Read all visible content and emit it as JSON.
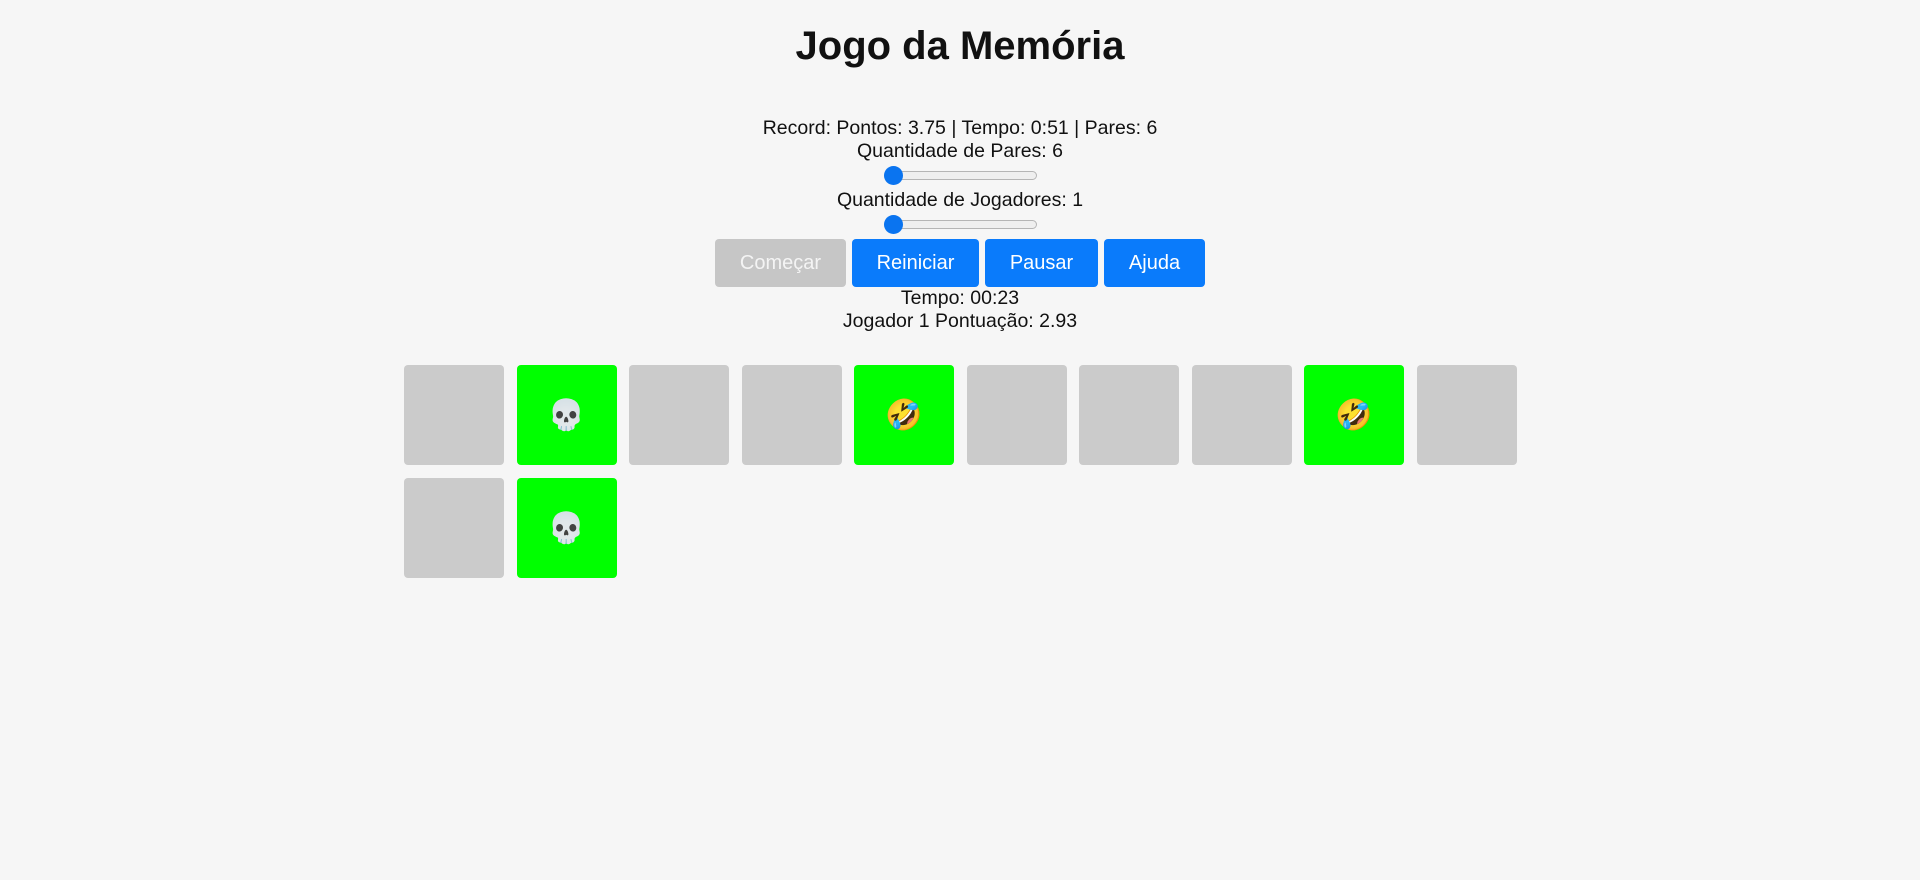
{
  "title": "Jogo da Memória",
  "record": "Record:  Pontos: 3.75 | Tempo: 0:51 | Pares: 6",
  "pairs": {
    "label": "Quantidade de Pares:  6",
    "value": 6
  },
  "players": {
    "label": "Quantidade de Jogadores:  1",
    "value": 1
  },
  "buttons": {
    "start": "Começar",
    "restart": "Reiniciar",
    "pause": "Pausar",
    "help": "Ajuda"
  },
  "timer": "Tempo: 00:23",
  "player_info": "Jogador 1  Pontuação:  2.93",
  "colors": {
    "primary_button": "#0a7bfb",
    "disabled_button": "#c6c6c6",
    "matched_card": "#00ff00",
    "hidden_card": "#cbcbcb"
  },
  "cards": [
    {
      "state": "hidden",
      "face": ""
    },
    {
      "state": "matched",
      "face": "💀",
      "icon": "skull-icon"
    },
    {
      "state": "hidden",
      "face": ""
    },
    {
      "state": "hidden",
      "face": ""
    },
    {
      "state": "matched",
      "face": "🤣",
      "icon": "rolling-laughing-face-icon"
    },
    {
      "state": "hidden",
      "face": ""
    },
    {
      "state": "hidden",
      "face": ""
    },
    {
      "state": "hidden",
      "face": ""
    },
    {
      "state": "matched",
      "face": "🤣",
      "icon": "rolling-laughing-face-icon"
    },
    {
      "state": "hidden",
      "face": ""
    },
    {
      "state": "hidden",
      "face": ""
    },
    {
      "state": "matched",
      "face": "💀",
      "icon": "skull-icon"
    }
  ]
}
